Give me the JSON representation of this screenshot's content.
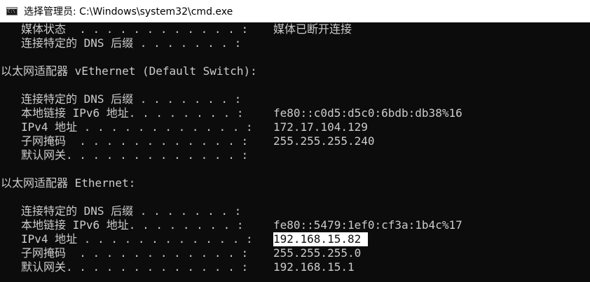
{
  "window": {
    "title": "选择管理员: C:\\Windows\\system32\\cmd.exe",
    "icon_prompt": "C:\\"
  },
  "console": {
    "lines": [
      {
        "label": "媒体状态  . . . . . . . . . . . . :",
        "value": "媒体已断开连接"
      },
      {
        "label": "连接特定的 DNS 后缀 . . . . . . . :",
        "value": ""
      },
      {
        "heading": "以太网适配器 vEthernet (Default Switch):"
      },
      {
        "label": "连接特定的 DNS 后缀 . . . . . . . :",
        "value": ""
      },
      {
        "label": "本地链接 IPv6 地址. . . . . . . . :",
        "value": "fe80::c0d5:d5c0:6bdb:db38%16"
      },
      {
        "label": "IPv4 地址 . . . . . . . . . . . . :",
        "value": "172.17.104.129"
      },
      {
        "label": "子网掩码  . . . . . . . . . . . . :",
        "value": "255.255.255.240"
      },
      {
        "label": "默认网关. . . . . . . . . . . . . :",
        "value": ""
      },
      {
        "heading": "以太网适配器 Ethernet:"
      },
      {
        "label": "连接特定的 DNS 后缀 . . . . . . . :",
        "value": ""
      },
      {
        "label": "本地链接 IPv6 地址. . . . . . . . :",
        "value": "fe80::5479:1ef0:cf3a:1b4c%17"
      },
      {
        "label": "IPv4 地址 . . . . . . . . . . . . :",
        "value": "192.168.15.82"
      },
      {
        "label": "子网掩码  . . . . . . . . . . . . :",
        "value": "255.255.255.0"
      },
      {
        "label": "默认网关. . . . . . . . . . . . . :",
        "value": "192.168.15.1"
      }
    ]
  },
  "selection": {
    "selected_text": "192.168.15.82"
  }
}
